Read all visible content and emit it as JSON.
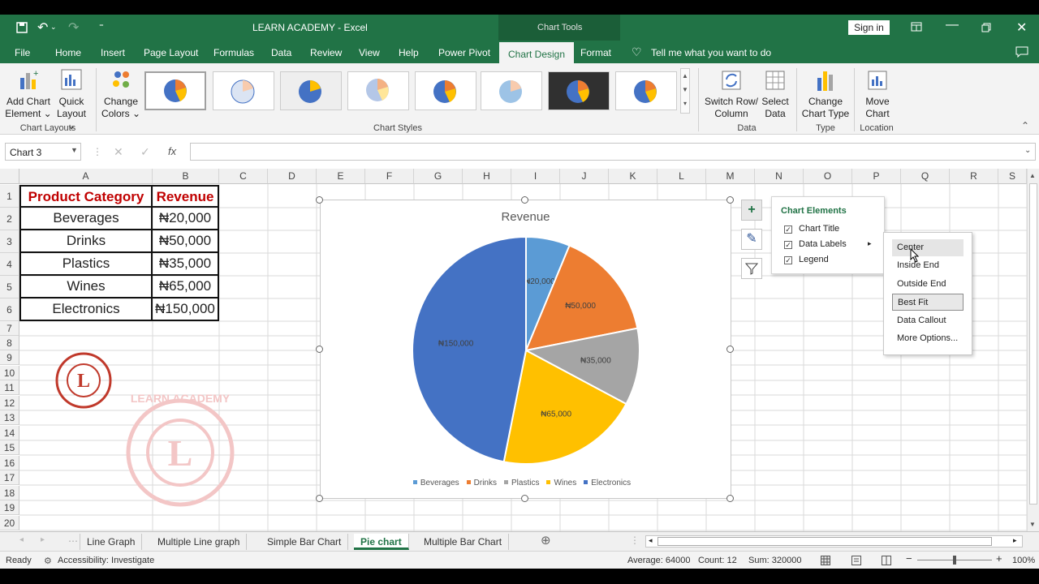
{
  "window": {
    "title": "LEARN ACADEMY  -  Excel",
    "context_tab_title": "Chart Tools",
    "sign_in": "Sign in"
  },
  "menu": {
    "tabs": [
      "File",
      "Home",
      "Insert",
      "Page Layout",
      "Formulas",
      "Data",
      "Review",
      "View",
      "Help",
      "Power Pivot",
      "Chart Design",
      "Format"
    ],
    "active": "Chart Design",
    "tell_me": "Tell me what you want to do"
  },
  "ribbon": {
    "add_chart_element": [
      "Add Chart",
      "Element ⌄"
    ],
    "quick_layout": [
      "Quick",
      "Layout ⌄"
    ],
    "change_colors": [
      "Change",
      "Colors ⌄"
    ],
    "chart_layouts_label": "Chart Layouts",
    "chart_styles_label": "Chart Styles",
    "switch_row_col": [
      "Switch Row/",
      "Column"
    ],
    "select_data": [
      "Select",
      "Data"
    ],
    "data_label": "Data",
    "change_chart_type": [
      "Change",
      "Chart Type"
    ],
    "type_label": "Type",
    "move_chart": [
      "Move",
      "Chart"
    ],
    "location_label": "Location"
  },
  "formula_bar": {
    "name_box": "Chart 3",
    "fx": "fx",
    "value": ""
  },
  "grid": {
    "columns": [
      "A",
      "B",
      "C",
      "D",
      "E",
      "F",
      "G",
      "H",
      "I",
      "J",
      "K",
      "L",
      "M",
      "N",
      "O",
      "P",
      "Q",
      "R",
      "S"
    ],
    "rows": [
      "1",
      "2",
      "3",
      "4",
      "5",
      "6",
      "7",
      "8",
      "9",
      "10",
      "11",
      "12",
      "13",
      "14",
      "15",
      "16",
      "17",
      "18",
      "19",
      "20"
    ]
  },
  "table": {
    "headers": [
      "Product Category",
      "Revenue"
    ],
    "rows": [
      [
        "Beverages",
        "₦20,000"
      ],
      [
        "Drinks",
        "₦50,000"
      ],
      [
        "Plastics",
        "₦35,000"
      ],
      [
        "Wines",
        "₦65,000"
      ],
      [
        "Electronics",
        "₦150,000"
      ]
    ]
  },
  "watermark": {
    "text": "LEARN ACADEMY"
  },
  "chart_data": {
    "type": "pie",
    "title": "Revenue",
    "categories": [
      "Beverages",
      "Drinks",
      "Plastics",
      "Wines",
      "Electronics"
    ],
    "values": [
      20000,
      50000,
      35000,
      65000,
      150000
    ],
    "data_labels": [
      "₦20,000",
      "₦50,000",
      "₦35,000",
      "₦65,000",
      "₦150,000"
    ],
    "colors": [
      "#5b9bd5",
      "#ed7d31",
      "#a5a5a5",
      "#ffc000",
      "#4472c4"
    ],
    "legend": "bottom"
  },
  "chart_elements_panel": {
    "title": "Chart Elements",
    "items": [
      {
        "label": "Chart Title",
        "checked": true
      },
      {
        "label": "Data Labels",
        "checked": true
      },
      {
        "label": "Legend",
        "checked": true
      }
    ]
  },
  "data_labels_submenu": [
    "Center",
    "Inside End",
    "Outside End",
    "Best Fit",
    "Data Callout",
    "More Options..."
  ],
  "sheets": {
    "tabs": [
      "Line Graph",
      "Multiple Line graph",
      "Simple Bar Chart",
      "Pie chart",
      "Multiple Bar Chart"
    ],
    "active": "Pie chart"
  },
  "status": {
    "ready": "Ready",
    "accessibility": "Accessibility: Investigate",
    "average": "Average: 64000",
    "count": "Count: 12",
    "sum": "Sum: 320000",
    "zoom": "100%"
  },
  "colors": {
    "excel_green": "#217346",
    "header_red": "#c00000"
  }
}
